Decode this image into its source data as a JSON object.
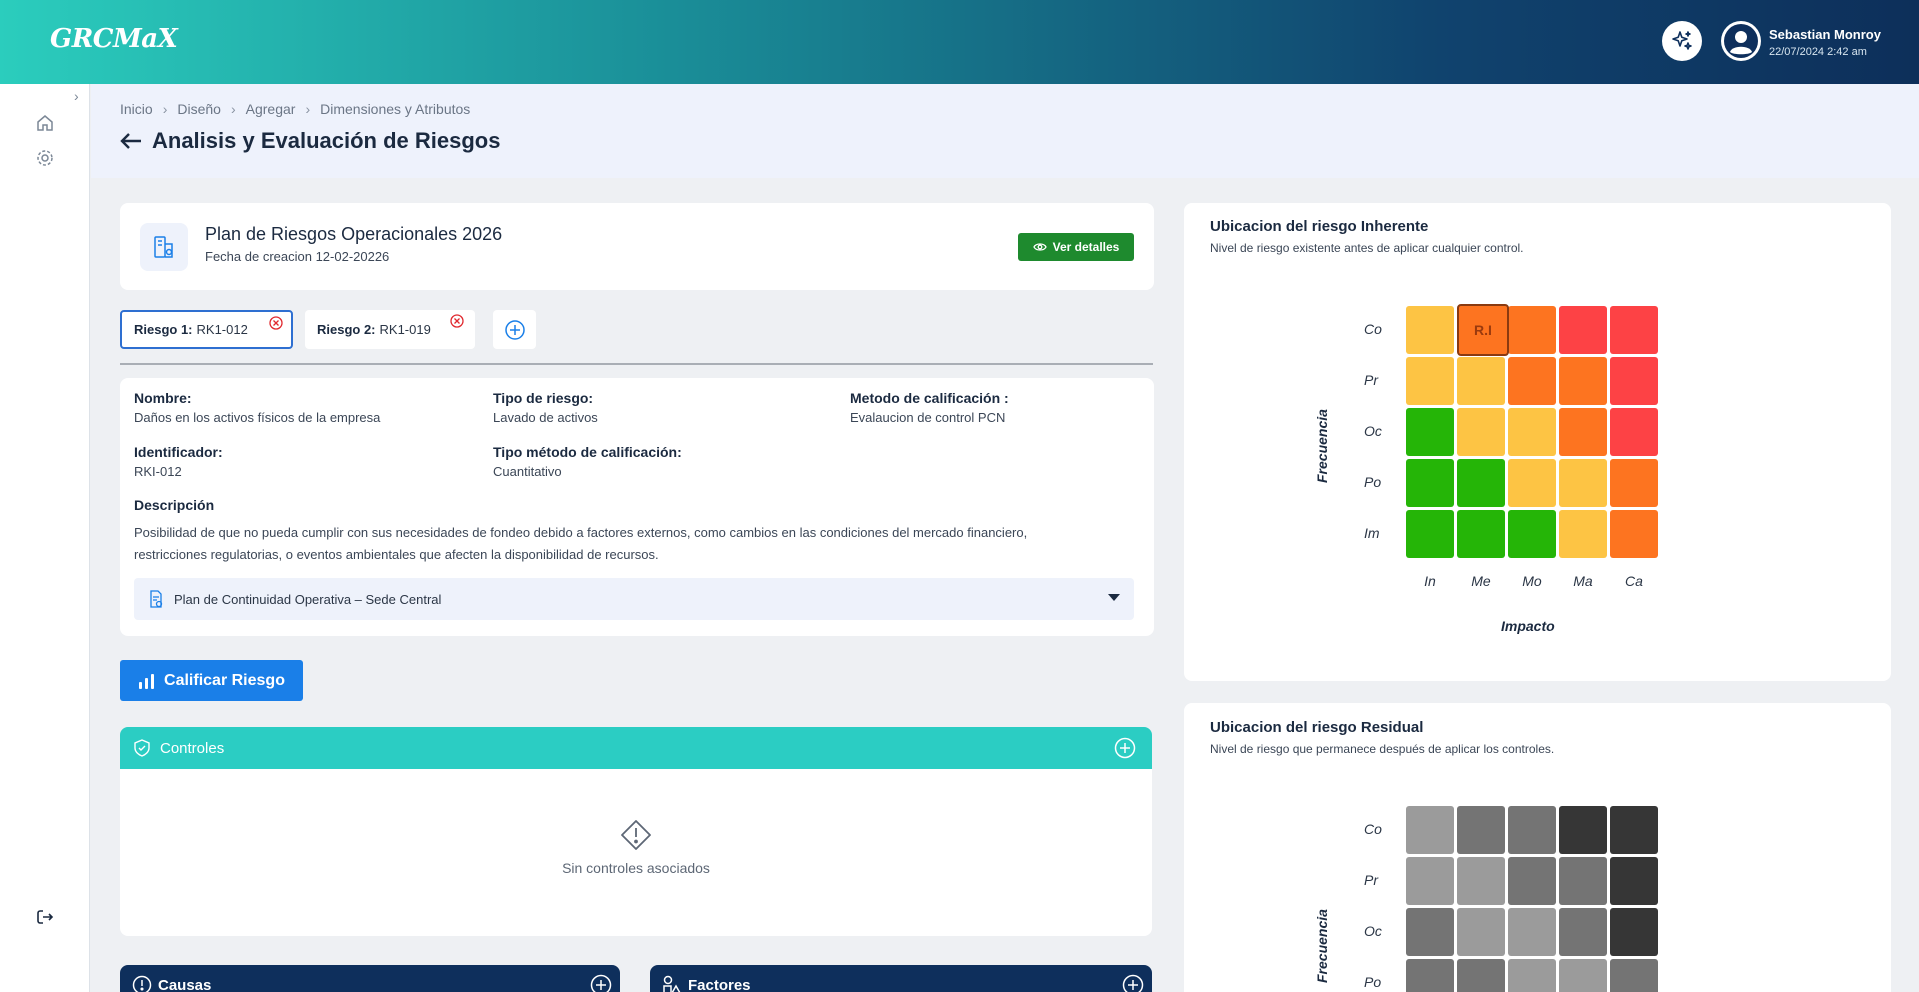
{
  "header": {
    "logo": "GRCMaX",
    "user_name": "Sebastian Monroy",
    "user_date": "22/07/2024  2:42 am"
  },
  "breadcrumb": [
    "Inicio",
    "Diseño",
    "Agregar",
    "Dimensiones y Atributos"
  ],
  "page_title": "Analisis y Evaluación de Riesgos",
  "plan": {
    "title": "Plan de Riesgos Operacionales 2026",
    "date": "Fecha de creacion 12-02-20226",
    "details_button": "Ver detalles"
  },
  "risk_tabs": [
    {
      "label": "Riesgo 1:",
      "code": "RK1-012"
    },
    {
      "label": "Riesgo 2:",
      "code": "RK1-019"
    }
  ],
  "detail": {
    "nombre_label": "Nombre:",
    "nombre_value": "Daños en los activos físicos de la empresa",
    "tipo_label": "Tipo de riesgo:",
    "tipo_value": "Lavado de activos",
    "metodo_label": "Metodo de calificación :",
    "metodo_value": "Evalaucion de control PCN",
    "id_label": "Identificador:",
    "id_value": "RKI-012",
    "tipo_metodo_label": "Tipo método de calificación:",
    "tipo_metodo_value": "Cuantitativo",
    "desc_label": "Descripción",
    "desc_value": "Posibilidad de que no pueda cumplir con sus necesidades de fondeo debido a factores externos, como cambios en las condiciones del mercado financiero, restricciones regulatorias, o eventos ambientales que afecten la disponibilidad de recursos.",
    "plan_select": "Plan de Continuidad Operativa – Sede Central"
  },
  "calificar_button": "Calificar Riesgo",
  "controles": {
    "title": "Controles",
    "empty": "Sin controles asociados"
  },
  "causas_title": "Causas",
  "factores_title": "Factores",
  "inherente": {
    "title": "Ubicacion del riesgo Inherente",
    "subtitle": "Nivel de riesgo existente antes de aplicar cualquier control.",
    "marker": "R.I",
    "y_axis": "Frecuencia",
    "x_axis": "Impacto"
  },
  "residual": {
    "title": "Ubicacion del riesgo Residual",
    "subtitle": "Nivel de riesgo que permanece después de aplicar los controles.",
    "y_axis": "Frecuencia"
  },
  "chart_data": [
    {
      "type": "heatmap",
      "title": "Ubicacion del riesgo Inherente",
      "rows": [
        "Co",
        "Pr",
        "Oc",
        "Po",
        "Im"
      ],
      "columns": [
        "In",
        "Me",
        "Mo",
        "Ma",
        "Ca"
      ],
      "ylabel": "Frecuencia",
      "xlabel": "Impacto",
      "levels": [
        [
          "yellow",
          "orange",
          "orange",
          "red",
          "red"
        ],
        [
          "yellow",
          "yellow",
          "orange",
          "orange",
          "red"
        ],
        [
          "green",
          "yellow",
          "yellow",
          "orange",
          "red"
        ],
        [
          "green",
          "green",
          "yellow",
          "yellow",
          "orange"
        ],
        [
          "green",
          "green",
          "green",
          "yellow",
          "orange"
        ]
      ],
      "marker": {
        "label": "R.I",
        "row": "Co",
        "column": "Me"
      }
    },
    {
      "type": "heatmap",
      "title": "Ubicacion del riesgo Residual",
      "rows": [
        "Co",
        "Pr",
        "Oc",
        "Po"
      ],
      "ylabel": "Frecuencia",
      "levels": [
        [
          "light",
          "mid",
          "mid",
          "dark",
          "dark"
        ],
        [
          "light",
          "light",
          "mid",
          "mid",
          "dark"
        ],
        [
          "mid",
          "light",
          "light",
          "mid",
          "dark"
        ],
        [
          "mid",
          "mid",
          "light",
          "light",
          "mid"
        ]
      ]
    }
  ],
  "colors": {
    "green": "#25b507",
    "yellow": "#fdc444",
    "orange": "#fd7420",
    "red": "#fd4245",
    "light": "#9b9b9b",
    "mid": "#747474",
    "dark": "#363636",
    "primary_button": "#1a7fe8",
    "details_button": "#1e8a2e",
    "controles_bar": "#2bcdc3",
    "section_bar": "#0e2f5c"
  }
}
